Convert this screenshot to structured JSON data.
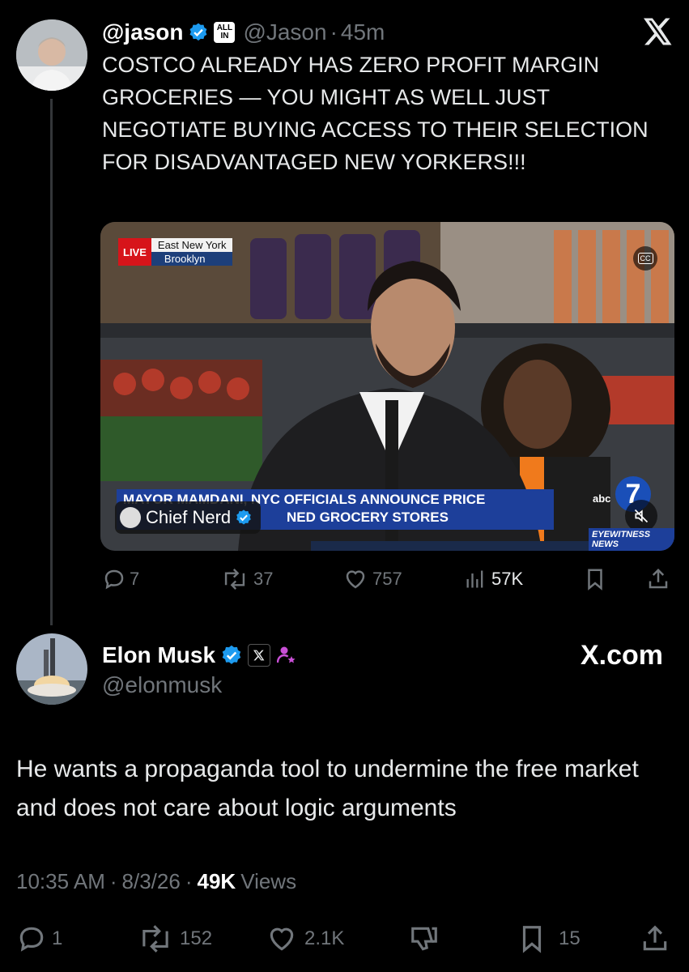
{
  "quoted_tweet": {
    "display_name": "@jason",
    "allin_badge_line1": "ALL",
    "allin_badge_line2": "IN",
    "handle": "@Jason",
    "separator": "·",
    "time": "45m",
    "text": "COSTCO ALREADY HAS ZERO PROFIT MARGIN GROCERIES — YOU MIGHT AS WELL JUST NEGOTIATE BUYING ACCESS TO THEIR SELECTION FOR DISADVANTAGED NEW YORKERS!!!",
    "video": {
      "live_label": "LIVE",
      "location_line1": "East New York",
      "location_line2": "Brooklyn",
      "cc_label": "CC",
      "headline": "MAYOR MAMDANI, NYC OFFICIALS ANNOUNCE PRICE",
      "subheadline": "NED GROCERY STORES",
      "overlay_credit": "Chief Nerd",
      "abc_label": "abc",
      "abc_number": "7",
      "eyewitness": "EYEWITNESS NEWS"
    },
    "actions": {
      "replies": "7",
      "reposts": "37",
      "likes": "757",
      "views": "57K"
    }
  },
  "main_tweet": {
    "display_name": "Elon Musk",
    "handle": "@elonmusk",
    "affiliation": "X.com",
    "text": "He wants a propaganda tool to undermine the free market and does not care about logic arguments",
    "time": "10:35 AM",
    "date": "8/3/26",
    "separator": "·",
    "views_count": "49K",
    "views_label": "Views",
    "actions": {
      "replies": "1",
      "reposts": "152",
      "likes": "2.1K",
      "bookmarks": "15"
    }
  },
  "colors": {
    "background": "#000000",
    "text": "#e7e9ea",
    "muted": "#71767b",
    "verified_blue": "#1d9bf0",
    "live_red": "#d7141a"
  }
}
